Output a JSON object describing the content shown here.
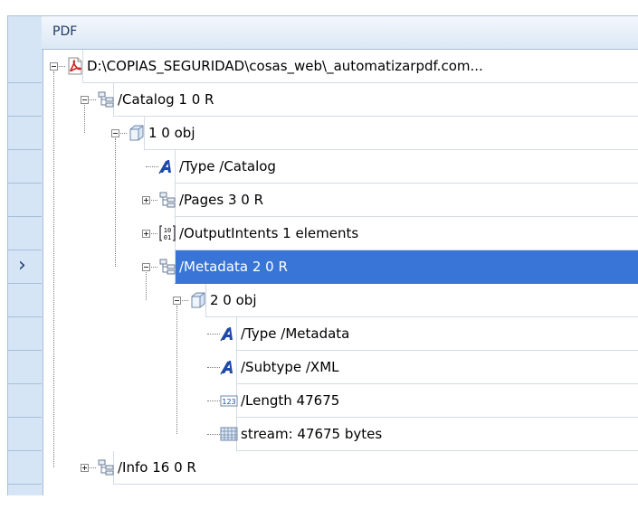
{
  "header": {
    "title": "PDF"
  },
  "tree": [
    {
      "label": "D:\\COPIAS_SEGURIDAD\\cosas_web\\_automatizarpdf.com...",
      "icon": "pdf-file-icon",
      "toggle": "expanded",
      "selected": false
    },
    {
      "label": "/Catalog 1 0 R",
      "icon": "reference-icon",
      "toggle": "expanded",
      "selected": false
    },
    {
      "label": "1 0 obj",
      "icon": "object-cube-icon",
      "toggle": "expanded",
      "selected": false
    },
    {
      "label": "/Type /Catalog",
      "icon": "name-icon",
      "toggle": "none",
      "selected": false
    },
    {
      "label": "/Pages 3 0 R",
      "icon": "reference-icon",
      "toggle": "collapsed",
      "selected": false
    },
    {
      "label": "/OutputIntents 1 elements",
      "icon": "array-icon",
      "toggle": "collapsed",
      "selected": false
    },
    {
      "label": "/Metadata 2 0 R",
      "icon": "reference-icon",
      "toggle": "expanded",
      "selected": true
    },
    {
      "label": "2 0 obj",
      "icon": "object-cube-icon",
      "toggle": "expanded",
      "selected": false
    },
    {
      "label": "/Type /Metadata",
      "icon": "name-icon",
      "toggle": "none",
      "selected": false
    },
    {
      "label": "/Subtype /XML",
      "icon": "name-icon",
      "toggle": "none",
      "selected": false
    },
    {
      "label": "/Length 47675",
      "icon": "number-icon",
      "toggle": "none",
      "selected": false
    },
    {
      "label": "stream: 47675 bytes",
      "icon": "stream-icon",
      "toggle": "none",
      "selected": false
    },
    {
      "label": "/Info 16 0 R",
      "icon": "reference-icon",
      "toggle": "collapsed",
      "selected": false
    }
  ],
  "colors": {
    "selection": "#3875d7",
    "gutter": "#d6e5f6",
    "grid_line": "#a9bfd8"
  }
}
